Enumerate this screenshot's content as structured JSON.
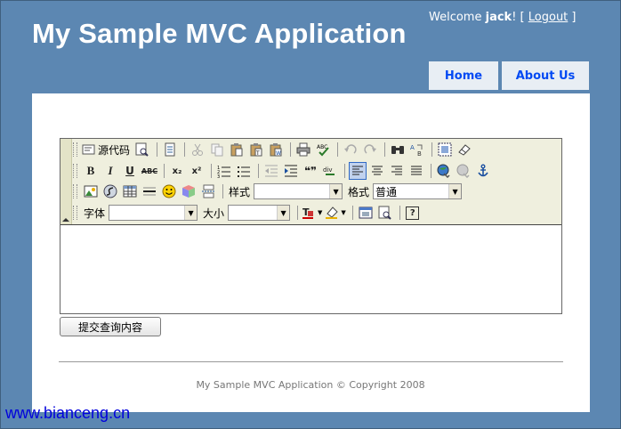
{
  "header": {
    "title": "My Sample MVC Application",
    "welcome_prefix": "Welcome ",
    "username": "jack",
    "welcome_suffix": "! [ ",
    "logout_label": "Logout",
    "welcome_close": " ]"
  },
  "nav": {
    "home_label": "Home",
    "about_label": "About Us"
  },
  "editor": {
    "source_label": "源代码",
    "style_label": "样式",
    "style_value": "",
    "format_label": "格式",
    "format_value": "普通",
    "font_label": "字体",
    "font_value": "",
    "size_label": "大小",
    "size_value": "",
    "bold_glyph": "B",
    "italic_glyph": "I",
    "underline_glyph": "U",
    "strike_glyph": "ABC",
    "subscript_glyph": "x₂",
    "superscript_glyph": "x²",
    "quote_glyph": "❝❞",
    "help_glyph": "?"
  },
  "submit_label": "提交查询内容",
  "footer": {
    "text": "My Sample MVC Application © Copyright 2008"
  },
  "watermark": "www.bianceng.cn",
  "colors": {
    "page_bg": "#5c87b2",
    "tab_bg": "#e8eef4",
    "tab_text": "#034af3",
    "toolbar_bg": "#efefde"
  }
}
